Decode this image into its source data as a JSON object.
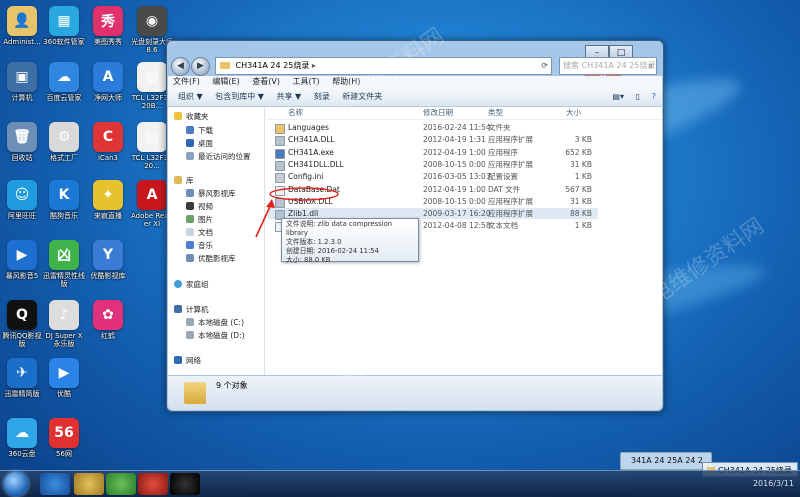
{
  "desktop_icons": [
    {
      "label": "Administ...",
      "color": "#e7c36a",
      "glyph": "👤"
    },
    {
      "label": "360软件管家",
      "color": "#29a8e0",
      "glyph": "▦"
    },
    {
      "label": "美图秀秀",
      "color": "#e0316a",
      "glyph": "秀"
    },
    {
      "label": "光盘刻录大师 8.6",
      "color": "#4a4a4a",
      "glyph": "◉"
    },
    {
      "label": "计算机",
      "color": "#3d6ea5",
      "glyph": "▣"
    },
    {
      "label": "百度云管家",
      "color": "#2f86e0",
      "glyph": "☁"
    },
    {
      "label": "净网大师",
      "color": "#2b7bd9",
      "glyph": "A"
    },
    {
      "label": "TCL L32F3320B...",
      "color": "#f2f2f2",
      "glyph": "▤"
    },
    {
      "label": "回收站",
      "color": "#6d8fb7",
      "glyph": "🗑"
    },
    {
      "label": "格式工厂",
      "color": "#d9d9d9",
      "glyph": "⚙"
    },
    {
      "label": "iCan3",
      "color": "#e03535",
      "glyph": "C"
    },
    {
      "label": "TCL L32F3320...",
      "color": "#f2f2f2",
      "glyph": "▤"
    },
    {
      "label": "阿里旺旺",
      "color": "#1f9be0",
      "glyph": "☺"
    },
    {
      "label": "酷狗音乐",
      "color": "#1a78d6",
      "glyph": "K"
    },
    {
      "label": "来疯直播",
      "color": "#e8c12f",
      "glyph": "✦"
    },
    {
      "label": "Adobe Reader XI",
      "color": "#c8161d",
      "glyph": "A"
    },
    {
      "label": "暴风影音5",
      "color": "#1d6fd0",
      "glyph": "▶"
    },
    {
      "label": "迅雷精灵性线版",
      "color": "#3fb34a",
      "glyph": "凶"
    },
    {
      "label": "优酷影视库",
      "color": "#3a7bd5",
      "glyph": "Y"
    },
    {
      "label": "腾讯QQ影视版",
      "color": "#111",
      "glyph": "Q"
    },
    {
      "label": "DJ Super X 永乐版",
      "color": "#ddd",
      "glyph": "♪"
    },
    {
      "label": "红鹤",
      "color": "#e0317a",
      "glyph": "✿"
    },
    {
      "label": "迅雷精简版",
      "color": "#1c6fc8",
      "glyph": "✈"
    },
    {
      "label": "优酷",
      "color": "#2a84e8",
      "glyph": "▶"
    },
    {
      "label": "360云盘",
      "color": "#2ea6e8",
      "glyph": "☁"
    },
    {
      "label": "56网",
      "color": "#e03030",
      "glyph": "56"
    }
  ],
  "window": {
    "breadcrumb": "CH341A 24 25烧录",
    "search_placeholder": "搜索 CH341A 24 25烧录",
    "menus": [
      "文件(F)",
      "编辑(E)",
      "查看(V)",
      "工具(T)",
      "帮助(H)"
    ],
    "toolbar": [
      "组织 ▼",
      "包含到库中 ▼",
      "共享 ▼",
      "刻录",
      "新建文件夹"
    ],
    "nav": {
      "favorites_title": "收藏夹",
      "favorites": [
        "下载",
        "桌面",
        "最近访问的位置"
      ],
      "libraries_title": "库",
      "libraries": [
        "暴风影视库",
        "视频",
        "图片",
        "文档",
        "音乐",
        "优酷影视库"
      ],
      "homegroup": "家庭组",
      "computer_title": "计算机",
      "drives": [
        "本地磁盘 (C:)",
        "本地磁盘 (D:)"
      ],
      "network": "网络"
    },
    "columns": {
      "name": "名称",
      "date": "修改日期",
      "type": "类型",
      "size": "大小"
    },
    "files": [
      {
        "name": "Languages",
        "date": "2016-02-24 11:54",
        "type": "文件夹",
        "size": "",
        "color": "#e8c467"
      },
      {
        "name": "CH341A.DLL",
        "date": "2012-04-19 1:31",
        "type": "应用程序扩展",
        "size": "3 KB",
        "color": "#b5c2d0"
      },
      {
        "name": "CH341A.exe",
        "date": "2012-04-19 1:00",
        "type": "应用程序",
        "size": "652 KB",
        "color": "#4b78b8"
      },
      {
        "name": "CH341DLL.DLL",
        "date": "2008-10-15 0:00",
        "type": "应用程序扩展",
        "size": "31 KB",
        "color": "#b5c2d0"
      },
      {
        "name": "Config.ini",
        "date": "2016-03-05 13:03",
        "type": "配置设置",
        "size": "1 KB",
        "color": "#c9cdd3"
      },
      {
        "name": "DataBase.Dat",
        "date": "2012-04-19 1:00",
        "type": "DAT 文件",
        "size": "567 KB",
        "color": "#f2f2f2"
      },
      {
        "name": "USBIOX.DLL",
        "date": "2008-10-15 0:00",
        "type": "应用程序扩展",
        "size": "31 KB",
        "color": "#b5c2d0"
      },
      {
        "name": "Zlib1.dll",
        "date": "2009-03-17 16:20",
        "type": "应用程序扩展",
        "size": "88 KB",
        "color": "#b5c2d0"
      },
      {
        "name": "",
        "date": "2012-04-08 12:58",
        "type": "文本文档",
        "size": "1 KB",
        "color": "#f2f2f2"
      }
    ],
    "tooltip": [
      "文件说明: zlib data compression library",
      "文件版本: 1.2.3.0",
      "创建日期: 2016-02-24 11:54",
      "大小: 88.0 KB"
    ],
    "status_count": "9 个对象"
  },
  "thumbnail_label": "341A 24 25A 24 2",
  "taskbar_window_label": "CH341A 24 25烧录",
  "tray_clock": "2016/3/11",
  "watermarks": [
    "家电维修资料网",
    "520101.com"
  ]
}
